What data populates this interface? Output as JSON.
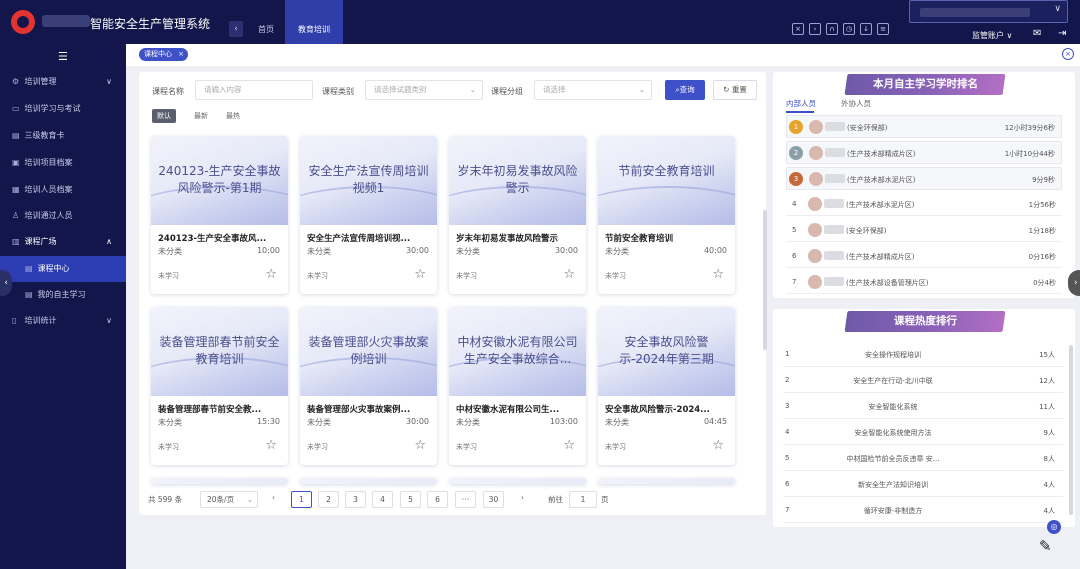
{
  "header": {
    "app_title": "智能安全生产管理系统",
    "tabs": [
      {
        "label": "首页"
      },
      {
        "label": "教育培训"
      }
    ],
    "user_name": "监管账户"
  },
  "sidebar": {
    "items": [
      {
        "label": "培训管理",
        "icon": "gear-icon",
        "arrow": "∨"
      },
      {
        "label": "培训学习与考试",
        "icon": "book-icon"
      },
      {
        "label": "三级教育卡",
        "icon": "card-icon"
      },
      {
        "label": "培训项目档案",
        "icon": "folder-icon"
      },
      {
        "label": "培训人员档案",
        "icon": "archive-icon"
      },
      {
        "label": "培训通过人员",
        "icon": "user-icon"
      },
      {
        "label": "课程广场",
        "icon": "grid-icon",
        "arrow": "∧"
      },
      {
        "label": "课程中心",
        "icon": "list-icon"
      },
      {
        "label": "我的自主学习",
        "icon": "list-icon"
      },
      {
        "label": "培训统计",
        "icon": "chart-icon",
        "arrow": "∨"
      }
    ]
  },
  "tagsbar": {
    "active_tag": "课程中心"
  },
  "filters": {
    "name_label": "课程名称",
    "name_placeholder": "请输入内容",
    "category_label": "课程类别",
    "category_placeholder": "请选择试题类别",
    "group_label": "课程分组",
    "group_placeholder": "请选择",
    "query_label": "查询",
    "reset_label": "重置"
  },
  "sort": {
    "options": [
      "默认",
      "最新",
      "最热"
    ]
  },
  "courses": [
    {
      "thumb": "240123-生产安全事故风险警示-第1期",
      "title": "240123-生产安全事故风...",
      "category": "未分类",
      "duration": "10:00",
      "status": "未学习"
    },
    {
      "thumb": "安全生产法宣传周培训视频1",
      "title": "安全生产法宣传周培训视...",
      "category": "未分类",
      "duration": "30:00",
      "status": "未学习"
    },
    {
      "thumb": "岁末年初易发事故风险警示",
      "title": "岁末年初易发事故风险警示",
      "category": "未分类",
      "duration": "30:00",
      "status": "未学习"
    },
    {
      "thumb": "节前安全教育培训",
      "title": "节前安全教育培训",
      "category": "未分类",
      "duration": "40:00",
      "status": "未学习"
    },
    {
      "thumb": "装备管理部春节前安全教育培训",
      "title": "装备管理部春节前安全教...",
      "category": "未分类",
      "duration": "15:30",
      "status": "未学习"
    },
    {
      "thumb": "装备管理部火灾事故案例培训",
      "title": "装备管理部火灾事故案例...",
      "category": "未分类",
      "duration": "30:00",
      "status": "未学习"
    },
    {
      "thumb": "中材安徽水泥有限公司生产安全事故综合...",
      "title": "中材安徽水泥有限公司生...",
      "category": "未分类",
      "duration": "103:00",
      "status": "未学习"
    },
    {
      "thumb": "安全事故风险警示-2024年第三期",
      "title": "安全事故风险警示-2024...",
      "category": "未分类",
      "duration": "04:45",
      "status": "未学习"
    }
  ],
  "pagination": {
    "total": "共 599 条",
    "page_size": "20条/页",
    "pages": [
      "1",
      "2",
      "3",
      "4",
      "5",
      "6",
      "···",
      "30"
    ],
    "goto_label": "前往",
    "goto_value": "1",
    "page_unit": "页"
  },
  "ranking": {
    "title": "本月自主学习学时排名",
    "tabs": [
      "内部人员",
      "外协人员"
    ],
    "rows": [
      {
        "rank": "1",
        "dept": "(安全环保部)",
        "time": "12小时39分6秒"
      },
      {
        "rank": "2",
        "dept": "(生产技术部精成片区)",
        "time": "1小时10分44秒"
      },
      {
        "rank": "3",
        "dept": "(生产技术部水泥片区)",
        "time": "9分9秒"
      },
      {
        "rank": "4",
        "dept": "(生产技术部水泥片区)",
        "time": "1分56秒"
      },
      {
        "rank": "5",
        "dept": "(安全环保部)",
        "time": "1分18秒"
      },
      {
        "rank": "6",
        "dept": "(生产技术部精成片区)",
        "time": "0分16秒"
      },
      {
        "rank": "7",
        "dept": "(生产技术部设备管理片区)",
        "time": "0分4秒"
      }
    ]
  },
  "heat": {
    "title": "课程热度排行",
    "rows": [
      {
        "rank": "1",
        "name": "安全操作规程培训",
        "count": "15人"
      },
      {
        "rank": "2",
        "name": "安全生产在行动-北川中联",
        "count": "12人"
      },
      {
        "rank": "3",
        "name": "安全智能化系统",
        "count": "11人"
      },
      {
        "rank": "4",
        "name": "安全智能化系统使用方法",
        "count": "9人"
      },
      {
        "rank": "5",
        "name": "中材国检节前全员反违章 安...",
        "count": "8人"
      },
      {
        "rank": "6",
        "name": "新安全生产法知识培训",
        "count": "4人"
      },
      {
        "rank": "7",
        "name": "循环安康-非制造方",
        "count": "4人"
      }
    ]
  },
  "colors": {
    "nav_bg": "#12164a",
    "accent": "#3f51c8",
    "medal_gold": "#e8a32a",
    "medal_silver": "#8aa0a8",
    "medal_bronze": "#c46a3a"
  }
}
